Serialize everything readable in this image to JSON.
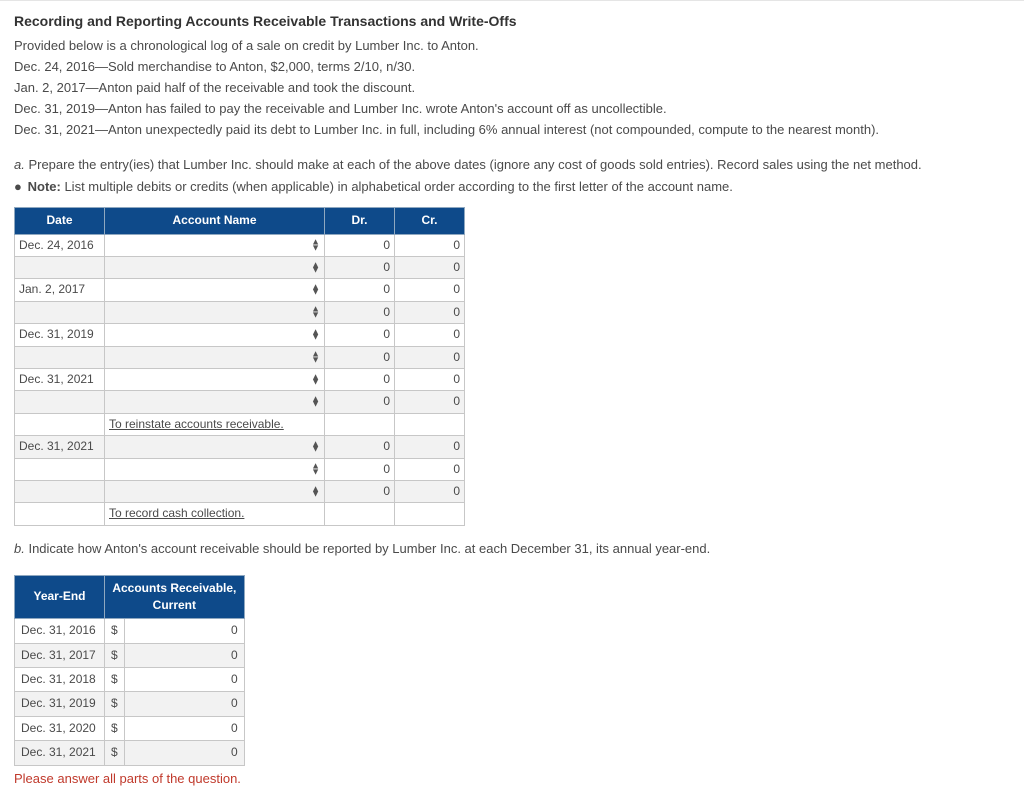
{
  "title": "Recording and Reporting Accounts Receivable Transactions and Write-Offs",
  "intro": "Provided below is a chronological log of a sale on credit by Lumber Inc. to Anton.",
  "events": [
    "Dec. 24, 2016—Sold merchandise to Anton, $2,000, terms 2/10, n/30.",
    "Jan. 2, 2017—Anton paid half of the receivable and took the discount.",
    "Dec. 31, 2019—Anton has failed to pay the receivable and Lumber Inc. wrote Anton's account off as uncollectible.",
    "Dec. 31, 2021—Anton unexpectedly paid its debt to Lumber Inc. in full, including 6% annual interest (not compounded, compute to the nearest month)."
  ],
  "partA": {
    "prefix": "a.",
    "text": " Prepare the entry(ies) that Lumber Inc. should make at each of the above dates (ignore any cost of goods sold entries). Record sales using the net method."
  },
  "noteLabel": "Note:",
  "noteText": " List multiple debits or credits (when applicable) in alphabetical order according to the first letter of the account name.",
  "journal": {
    "headers": {
      "date": "Date",
      "account": "Account Name",
      "dr": "Dr.",
      "cr": "Cr."
    },
    "rows": [
      {
        "date": "Dec. 24, 2016",
        "account": "",
        "dr": "0",
        "cr": "0",
        "select": true
      },
      {
        "date": "",
        "account": "",
        "dr": "0",
        "cr": "0",
        "select": true
      },
      {
        "date": "Jan. 2, 2017",
        "account": "",
        "dr": "0",
        "cr": "0",
        "select": true
      },
      {
        "date": "",
        "account": "",
        "dr": "0",
        "cr": "0",
        "select": true
      },
      {
        "date": "Dec. 31, 2019",
        "account": "",
        "dr": "0",
        "cr": "0",
        "select": true
      },
      {
        "date": "",
        "account": "",
        "dr": "0",
        "cr": "0",
        "select": true
      },
      {
        "date": "Dec. 31, 2021",
        "account": "",
        "dr": "0",
        "cr": "0",
        "select": true
      },
      {
        "date": "",
        "account": "",
        "dr": "0",
        "cr": "0",
        "select": true
      },
      {
        "date": "",
        "account": "To reinstate accounts receivable.",
        "dr": "",
        "cr": "",
        "select": false,
        "note": true
      },
      {
        "date": "Dec. 31, 2021",
        "account": "",
        "dr": "0",
        "cr": "0",
        "select": true
      },
      {
        "date": "",
        "account": "",
        "dr": "0",
        "cr": "0",
        "select": true
      },
      {
        "date": "",
        "account": "",
        "dr": "0",
        "cr": "0",
        "select": true
      },
      {
        "date": "",
        "account": "To record cash collection.",
        "dr": "",
        "cr": "",
        "select": false,
        "note": true
      }
    ]
  },
  "partB": {
    "prefix": "b.",
    "text": " Indicate how Anton's account receivable should be reported by Lumber Inc. at each December 31, its annual year-end."
  },
  "balances": {
    "headers": {
      "year": "Year-End",
      "col": "Accounts Receivable, Current"
    },
    "rows": [
      {
        "year": "Dec. 31, 2016",
        "cur": "$",
        "val": "0"
      },
      {
        "year": "Dec. 31, 2017",
        "cur": "$",
        "val": "0"
      },
      {
        "year": "Dec. 31, 2018",
        "cur": "$",
        "val": "0"
      },
      {
        "year": "Dec. 31, 2019",
        "cur": "$",
        "val": "0"
      },
      {
        "year": "Dec. 31, 2020",
        "cur": "$",
        "val": "0"
      },
      {
        "year": "Dec. 31, 2021",
        "cur": "$",
        "val": "0"
      }
    ]
  },
  "warning": "Please answer all parts of the question."
}
